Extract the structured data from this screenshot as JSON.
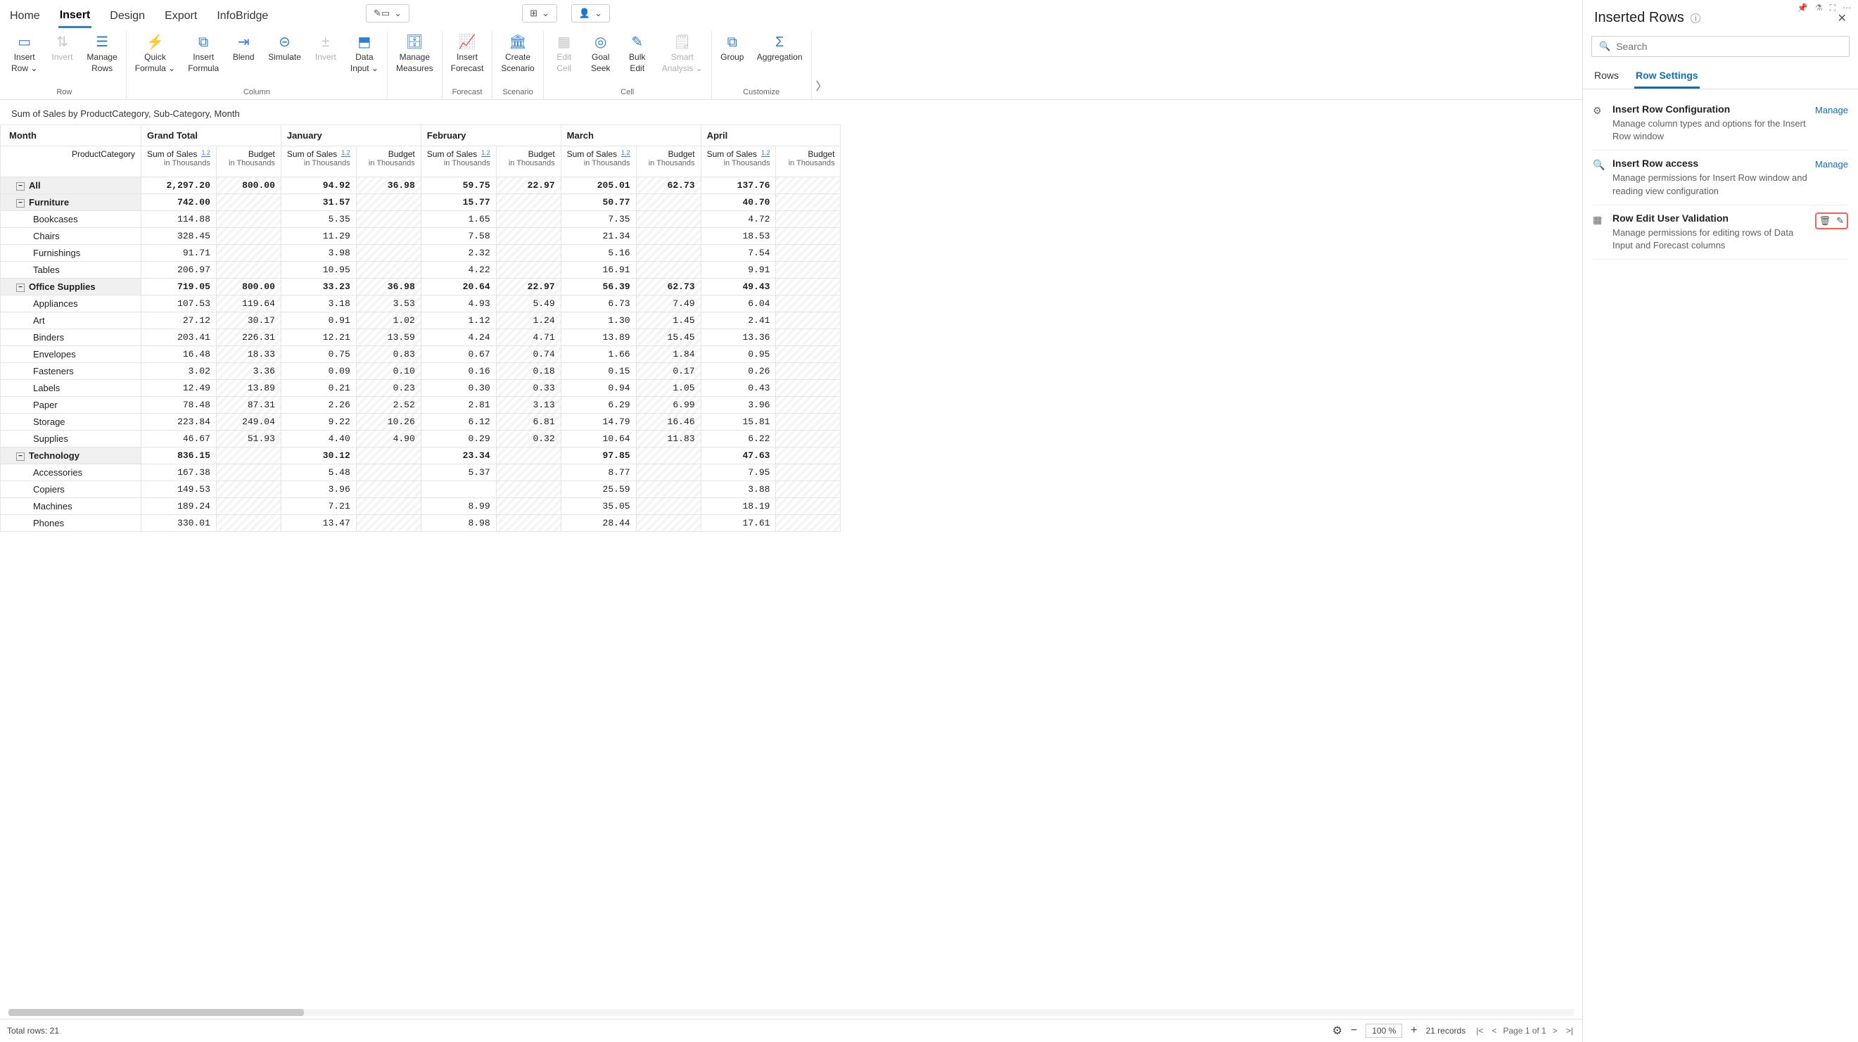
{
  "top_tabs": [
    "Home",
    "Insert",
    "Design",
    "Export",
    "InfoBridge"
  ],
  "active_top_tab": "Insert",
  "ribbon": {
    "groups": [
      {
        "label": "Row",
        "items": [
          {
            "label": "Insert\nRow ⌄",
            "icon": "▭"
          },
          {
            "label": "Invert",
            "icon": "⇅",
            "disabled": true
          },
          {
            "label": "Manage\nRows",
            "icon": "☰"
          }
        ]
      },
      {
        "label": "Column",
        "items": [
          {
            "label": "Quick\nFormula ⌄",
            "icon": "⚡"
          },
          {
            "label": "Insert\nFormula",
            "icon": "⧉"
          },
          {
            "label": "Blend",
            "icon": "⇥"
          },
          {
            "label": "Simulate",
            "icon": "⊝"
          },
          {
            "label": "Invert",
            "icon": "±",
            "disabled": true
          },
          {
            "label": "Data\nInput ⌄",
            "icon": "⬒"
          }
        ]
      },
      {
        "label": "",
        "items": [
          {
            "label": "Manage\nMeasures",
            "icon": "🗄"
          }
        ]
      },
      {
        "label": "Forecast",
        "items": [
          {
            "label": "Insert\nForecast",
            "icon": "📈"
          }
        ]
      },
      {
        "label": "Scenario",
        "items": [
          {
            "label": "Create\nScenario",
            "icon": "🏛"
          }
        ]
      },
      {
        "label": "Cell",
        "items": [
          {
            "label": "Edit\nCell",
            "icon": "▦",
            "disabled": true
          },
          {
            "label": "Goal\nSeek",
            "icon": "◎"
          },
          {
            "label": "Bulk\nEdit",
            "icon": "✎"
          },
          {
            "label": "Smart\nAnalysis ⌄",
            "icon": "🗒",
            "disabled": true
          }
        ]
      },
      {
        "label": "Customize",
        "items": [
          {
            "label": "Group",
            "icon": "⧉"
          },
          {
            "label": "Aggregation",
            "icon": "Σ"
          }
        ]
      }
    ]
  },
  "table_title": "Sum of Sales by ProductCategory, Sub-Category, Month",
  "months": [
    "Grand Total",
    "January",
    "February",
    "March",
    "April"
  ],
  "subheaders": [
    "Sum of Sales",
    "Budget"
  ],
  "sub_unit": "in Thousands",
  "sup_label": "1.2",
  "corner_top": "Month",
  "corner_sub": "ProductCategory",
  "rows": [
    {
      "label": "All",
      "type": "group",
      "vals": [
        "2,297.20",
        "800.00",
        "94.92",
        "36.98",
        "59.75",
        "22.97",
        "205.01",
        "62.73",
        "137.76"
      ]
    },
    {
      "label": "Furniture",
      "type": "group",
      "vals": [
        "742.00",
        "",
        "31.57",
        "",
        "15.77",
        "",
        "50.77",
        "",
        "40.70"
      ]
    },
    {
      "label": "Bookcases",
      "type": "item",
      "vals": [
        "114.88",
        "",
        "5.35",
        "",
        "1.65",
        "",
        "7.35",
        "",
        "4.72"
      ]
    },
    {
      "label": "Chairs",
      "type": "item",
      "vals": [
        "328.45",
        "",
        "11.29",
        "",
        "7.58",
        "",
        "21.34",
        "",
        "18.53"
      ]
    },
    {
      "label": "Furnishings",
      "type": "item",
      "vals": [
        "91.71",
        "",
        "3.98",
        "",
        "2.32",
        "",
        "5.16",
        "",
        "7.54"
      ]
    },
    {
      "label": "Tables",
      "type": "item",
      "vals": [
        "206.97",
        "",
        "10.95",
        "",
        "4.22",
        "",
        "16.91",
        "",
        "9.91"
      ]
    },
    {
      "label": "Office Supplies",
      "type": "group",
      "vals": [
        "719.05",
        "800.00",
        "33.23",
        "36.98",
        "20.64",
        "22.97",
        "56.39",
        "62.73",
        "49.43"
      ]
    },
    {
      "label": "Appliances",
      "type": "item",
      "vals": [
        "107.53",
        "119.64",
        "3.18",
        "3.53",
        "4.93",
        "5.49",
        "6.73",
        "7.49",
        "6.04"
      ]
    },
    {
      "label": "Art",
      "type": "item",
      "vals": [
        "27.12",
        "30.17",
        "0.91",
        "1.02",
        "1.12",
        "1.24",
        "1.30",
        "1.45",
        "2.41"
      ]
    },
    {
      "label": "Binders",
      "type": "item",
      "vals": [
        "203.41",
        "226.31",
        "12.21",
        "13.59",
        "4.24",
        "4.71",
        "13.89",
        "15.45",
        "13.36"
      ]
    },
    {
      "label": "Envelopes",
      "type": "item",
      "vals": [
        "16.48",
        "18.33",
        "0.75",
        "0.83",
        "0.67",
        "0.74",
        "1.66",
        "1.84",
        "0.95"
      ]
    },
    {
      "label": "Fasteners",
      "type": "item",
      "vals": [
        "3.02",
        "3.36",
        "0.09",
        "0.10",
        "0.16",
        "0.18",
        "0.15",
        "0.17",
        "0.26"
      ]
    },
    {
      "label": "Labels",
      "type": "item",
      "vals": [
        "12.49",
        "13.89",
        "0.21",
        "0.23",
        "0.30",
        "0.33",
        "0.94",
        "1.05",
        "0.43"
      ]
    },
    {
      "label": "Paper",
      "type": "item",
      "vals": [
        "78.48",
        "87.31",
        "2.26",
        "2.52",
        "2.81",
        "3.13",
        "6.29",
        "6.99",
        "3.96"
      ]
    },
    {
      "label": "Storage",
      "type": "item",
      "vals": [
        "223.84",
        "249.04",
        "9.22",
        "10.26",
        "6.12",
        "6.81",
        "14.79",
        "16.46",
        "15.81"
      ]
    },
    {
      "label": "Supplies",
      "type": "item",
      "vals": [
        "46.67",
        "51.93",
        "4.40",
        "4.90",
        "0.29",
        "0.32",
        "10.64",
        "11.83",
        "6.22"
      ]
    },
    {
      "label": "Technology",
      "type": "group",
      "vals": [
        "836.15",
        "",
        "30.12",
        "",
        "23.34",
        "",
        "97.85",
        "",
        "47.63"
      ]
    },
    {
      "label": "Accessories",
      "type": "item",
      "vals": [
        "167.38",
        "",
        "5.48",
        "",
        "5.37",
        "",
        "8.77",
        "",
        "7.95"
      ]
    },
    {
      "label": "Copiers",
      "type": "item",
      "vals": [
        "149.53",
        "",
        "3.96",
        "",
        "",
        "",
        "25.59",
        "",
        "3.88"
      ]
    },
    {
      "label": "Machines",
      "type": "item",
      "vals": [
        "189.24",
        "",
        "7.21",
        "",
        "8.99",
        "",
        "35.05",
        "",
        "18.19"
      ]
    },
    {
      "label": "Phones",
      "type": "item",
      "vals": [
        "330.01",
        "",
        "13.47",
        "",
        "8.98",
        "",
        "28.44",
        "",
        "17.61"
      ]
    }
  ],
  "footer": {
    "total_rows": "Total rows: 21",
    "zoom": "100 %",
    "records": "21 records",
    "page": "Page 1 of 1"
  },
  "sidebar": {
    "title": "Inserted Rows",
    "search_placeholder": "Search",
    "tabs": [
      "Rows",
      "Row Settings"
    ],
    "active_tab": "Row Settings",
    "items": [
      {
        "icon": "⚙",
        "title": "Insert Row Configuration",
        "desc": "Manage column types and options for the Insert Row window",
        "action": "Manage"
      },
      {
        "icon": "🔍",
        "title": "Insert Row access",
        "desc": "Manage permissions for Insert Row window and reading view configuration",
        "action": "Manage"
      },
      {
        "icon": "▦",
        "title": "Row Edit User Validation",
        "desc": "Manage permissions for editing rows of Data Input and Forecast columns",
        "action_icons": true
      }
    ]
  }
}
